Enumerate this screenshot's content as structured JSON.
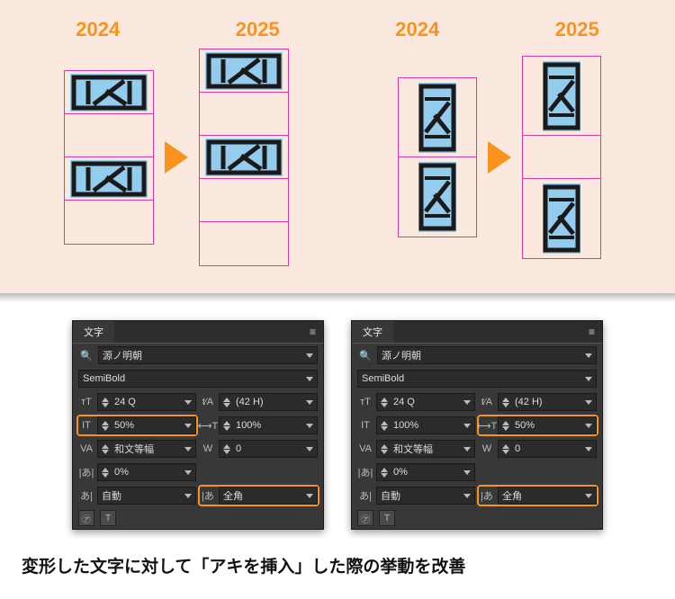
{
  "years": {
    "y1": "2024",
    "y2": "2025",
    "y3": "2024",
    "y4": "2025"
  },
  "panel": {
    "title": "文字",
    "font_search": "源ノ明朝",
    "weight": "SemiBold",
    "size": "24 Q",
    "leading": "(42 H)",
    "vscale_left": "50%",
    "hscale_left": "100%",
    "vscale_right": "100%",
    "hscale_right": "50%",
    "kerning": "和文等幅",
    "tracking": "0",
    "baseline": "0%",
    "tsume": "自動",
    "aki": "全角"
  },
  "caption": "変形した文字に対して「アキを挿入」した際の挙動を改善"
}
